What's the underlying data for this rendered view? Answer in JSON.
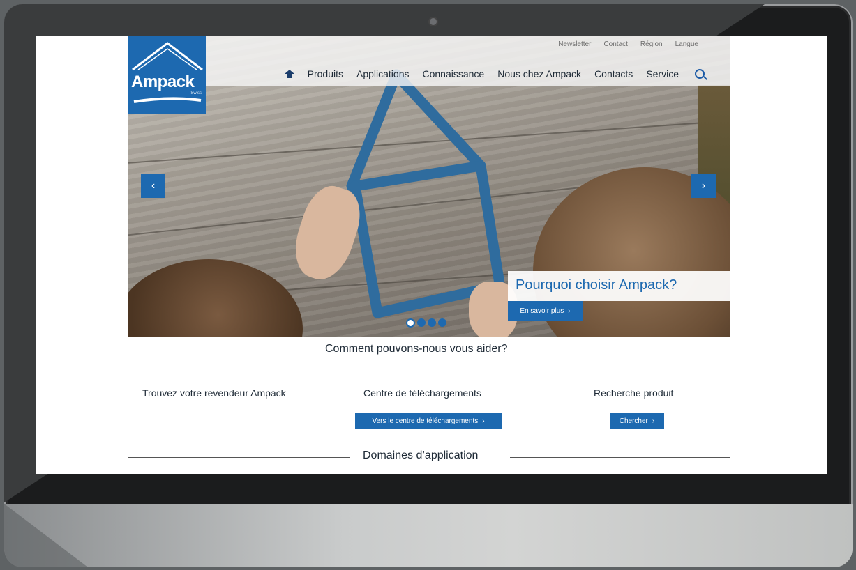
{
  "brand": {
    "name": "Ampack",
    "sub": "Swiss",
    "color": "#1d69b0"
  },
  "utility_nav": [
    "Newsletter",
    "Contact",
    "Région",
    "Langue"
  ],
  "main_nav": {
    "home_icon": "home-icon",
    "items": [
      "Produits",
      "Applications",
      "Connaissance",
      "Nous chez Ampack",
      "Contacts",
      "Service"
    ],
    "search_icon": "search-icon"
  },
  "hero": {
    "caption": "Pourquoi choisir Ampack?",
    "cta_label": "En savoir plus",
    "cta_icon": "chevron-right-icon",
    "prev_icon": "chevron-left-icon",
    "next_icon": "chevron-right-icon",
    "slide_count": 4,
    "active_slide": 1
  },
  "help_section": {
    "title": "Comment pouvons-nous vous aider?",
    "columns": [
      {
        "title": "Trouvez votre revendeur Ampack"
      },
      {
        "title": "Centre de téléchargements",
        "button": "Vers le centre de téléchargements"
      },
      {
        "title": "Recherche produit",
        "button": "Chercher"
      }
    ]
  },
  "domains_section": {
    "title": "Domaines d’application"
  }
}
